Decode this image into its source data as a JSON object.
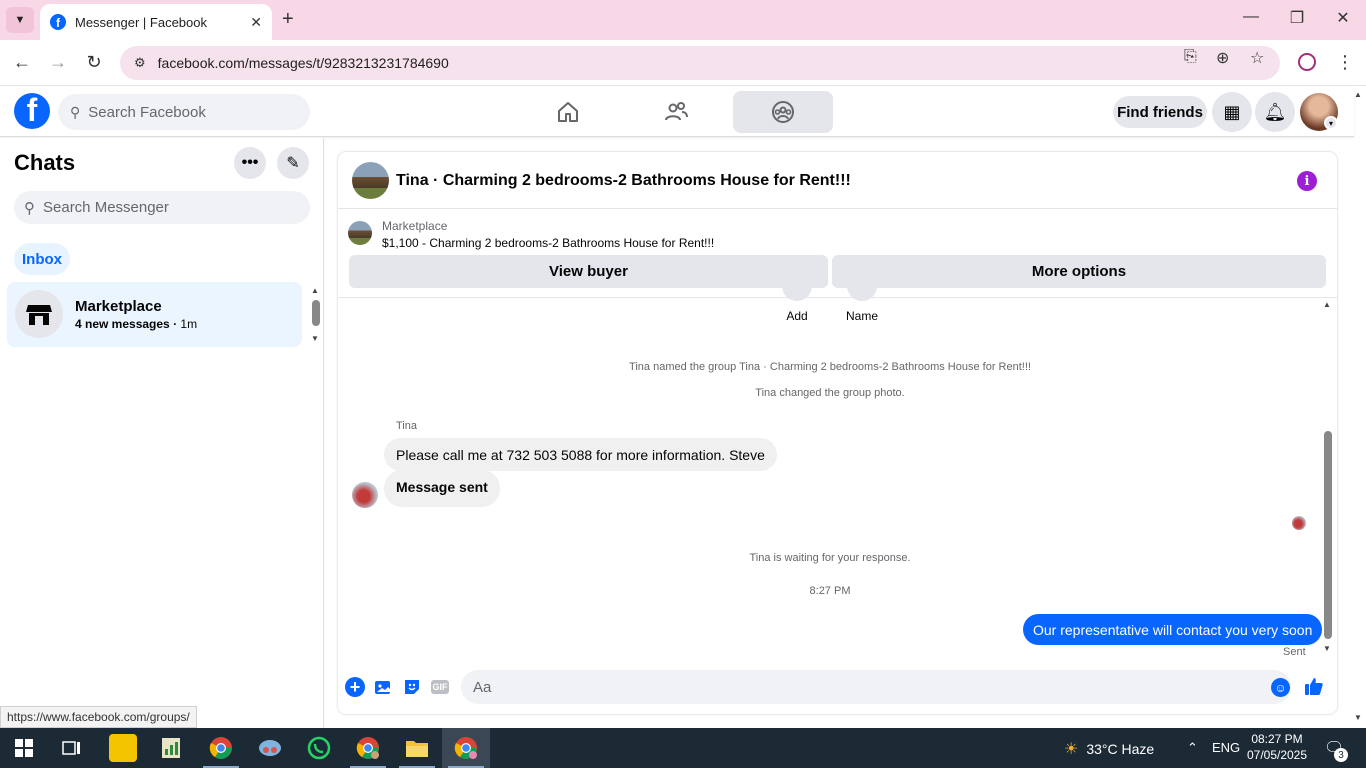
{
  "browser": {
    "tab_title": "Messenger | Facebook",
    "url": "facebook.com/messages/t/9283213231784690",
    "status_url": "https://www.facebook.com/groups/"
  },
  "fb_header": {
    "search_placeholder": "Search Facebook",
    "find_friends_label": "Find friends",
    "nav_items": [
      "home-icon",
      "friends-icon",
      "groups-icon"
    ],
    "active_nav": "groups-icon"
  },
  "sidebar": {
    "title": "Chats",
    "search_placeholder": "Search Messenger",
    "filter_label": "Inbox",
    "chats": [
      {
        "name": "Marketplace",
        "preview": "4 new messages",
        "time": "1m"
      }
    ]
  },
  "conversation": {
    "title": "Tina · Charming 2 bedrooms-2 Bathrooms House for Rent!!!",
    "marketplace_label": "Marketplace",
    "listing_text": "$1,100 - Charming 2 bedrooms-2 Bathrooms House for Rent!!!",
    "view_buyer_label": "View buyer",
    "more_options_label": "More options",
    "quick_actions": [
      {
        "label": "Add"
      },
      {
        "label": "Name"
      }
    ],
    "system_messages": {
      "renamed": "Tina named the group Tina · Charming 2 bedrooms-2 Bathrooms House for Rent!!!",
      "photo_changed": "Tina changed the group photo.",
      "waiting": "Tina is waiting for your response.",
      "timestamp": "8:27 PM"
    },
    "sender_name": "Tina",
    "incoming_messages": [
      "Please call me at 732 503 5088 for more information. Steve",
      "Message sent"
    ],
    "outgoing_message": "Our representative will contact you very soon",
    "sent_status": "Sent",
    "composer_placeholder": "Aa"
  },
  "taskbar": {
    "weather": "33°C  Haze",
    "language": "ENG",
    "time": "08:27 PM",
    "date": "07/05/2025",
    "notification_count": "3"
  },
  "colors": {
    "brand_blue": "#0866ff",
    "tab_bar": "#f8d7e6",
    "info_purple": "#9c1fd4",
    "taskbar": "#1c2a36"
  }
}
